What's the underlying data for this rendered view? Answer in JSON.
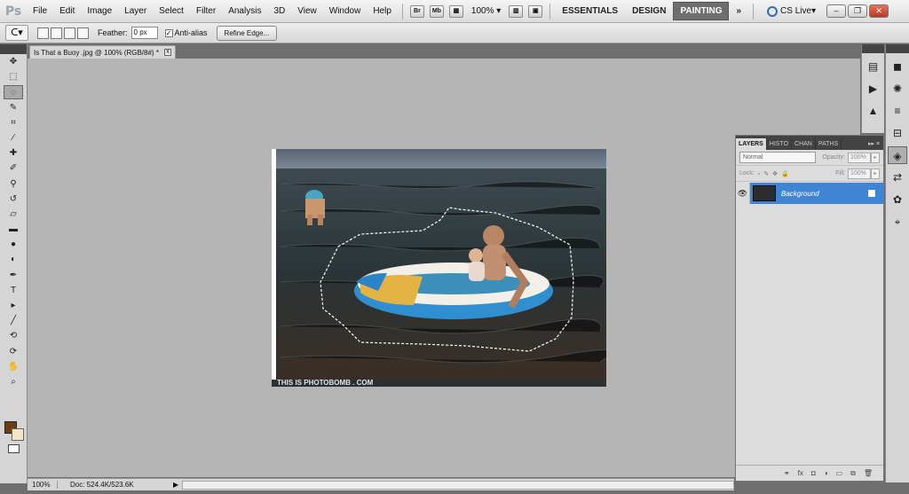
{
  "app": {
    "logo": "Ps"
  },
  "menu": [
    "File",
    "Edit",
    "Image",
    "Layer",
    "Select",
    "Filter",
    "Analysis",
    "3D",
    "View",
    "Window",
    "Help"
  ],
  "appbar": {
    "bridge": "Br",
    "minibridge": "Mb",
    "zoom": "100%",
    "workspaces": [
      "ESSENTIALS",
      "DESIGN",
      "PAINTING"
    ],
    "active_workspace": "PAINTING",
    "more": "»",
    "cslive": "CS Live"
  },
  "options": {
    "feather_label": "Feather:",
    "feather_value": "0 px",
    "antialias_label": "Anti-alias",
    "antialias_checked": true,
    "refine_label": "Refine Edge..."
  },
  "document": {
    "tab_title": "Is That  a Buoy .jpg @ 100% (RGB/8#) *"
  },
  "image": {
    "watermark": "THIS IS PHOTOBOMB . COM"
  },
  "status": {
    "zoom": "100%",
    "doc": "Doc: 524.4K/523.6K"
  },
  "layers_panel": {
    "tabs": [
      "LAYERS",
      "HISTO",
      "CHAN",
      "PATHS"
    ],
    "blend_mode": "Normal",
    "opacity_label": "Opacity:",
    "opacity_value": "100%",
    "lock_label": "Lock:",
    "fill_label": "Fill:",
    "fill_value": "100%",
    "layer_name": "Background"
  },
  "colors": {
    "foreground": "#6b3f12",
    "background": "#f4e7c8",
    "accent": "#3f85d3"
  }
}
